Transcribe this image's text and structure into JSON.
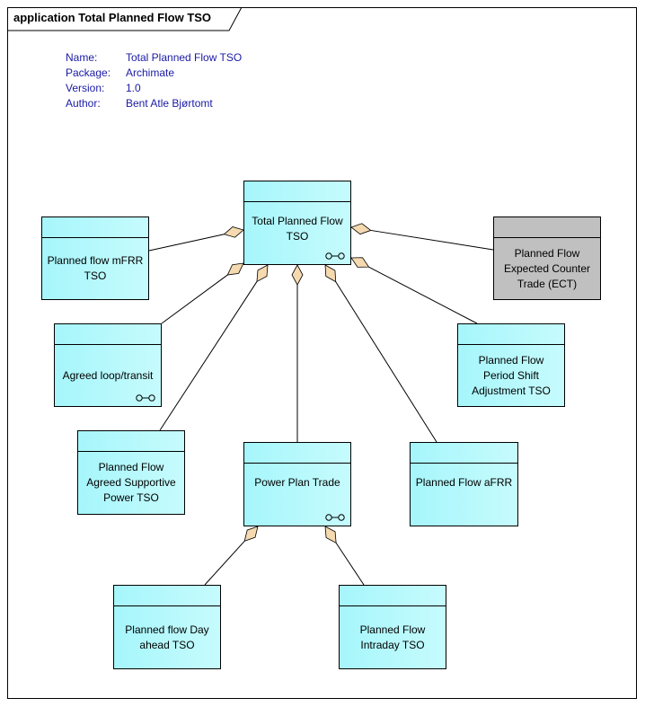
{
  "frame": {
    "title": "application Total Planned Flow TSO"
  },
  "meta": [
    {
      "key": "Name:",
      "value": "Total Planned Flow TSO"
    },
    {
      "key": "Package:",
      "value": "Archimate"
    },
    {
      "key": "Version:",
      "value": "1.0"
    },
    {
      "key": "Author:",
      "value": "Bent Atle Bjørtomt"
    }
  ],
  "nodes": {
    "total": {
      "label": "Total Planned Flow\nTSO",
      "icon": "interface-icon"
    },
    "mfrr": {
      "label": "Planned flow mFRR\nTSO"
    },
    "ect": {
      "label": "Planned Flow\nExpected Counter\nTrade (ECT)",
      "fill": "#c0c0c0"
    },
    "loop": {
      "label": "Agreed loop/transit",
      "icon": "interface-icon"
    },
    "period": {
      "label": "Planned Flow\nPeriod Shift\nAdjustment TSO"
    },
    "supportive": {
      "label": "Planned Flow\nAgreed Supportive\nPower TSO"
    },
    "powerplan": {
      "label": "Power Plan Trade",
      "icon": "interface-icon"
    },
    "afrr": {
      "label": "Planned Flow aFRR"
    },
    "dayahead": {
      "label": "Planned flow Day\nahead TSO"
    },
    "intraday": {
      "label": "Planned Flow\nIntraday TSO"
    }
  },
  "colors": {
    "element_fill": "#b0f8fc",
    "inactive_fill": "#c0c0c0",
    "diamond_fill": "#f5d9b0",
    "meta_text": "#1a1aa6"
  }
}
